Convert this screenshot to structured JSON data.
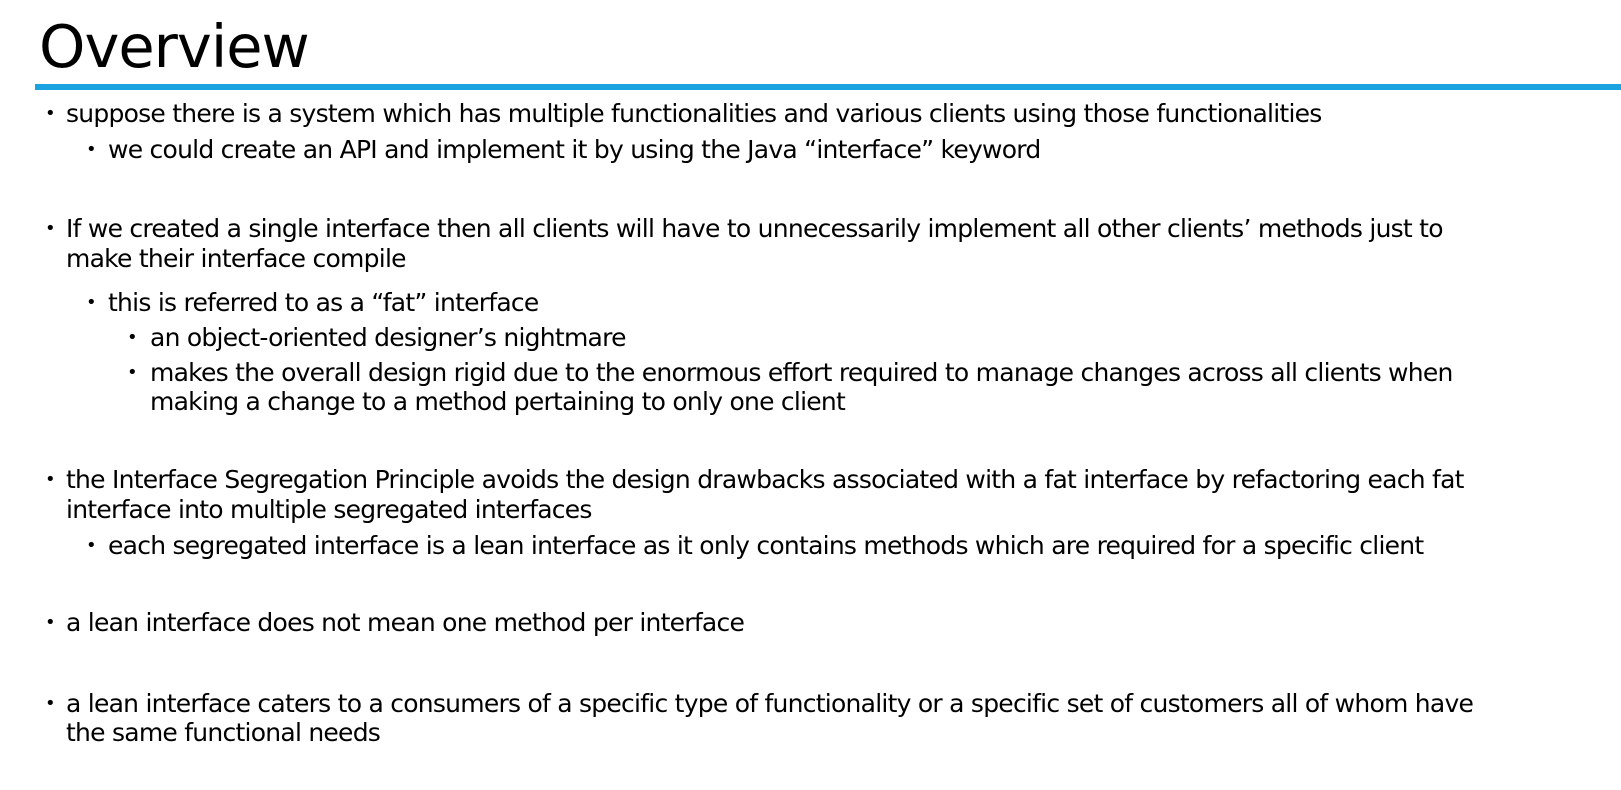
{
  "slide": {
    "title": "Overview",
    "accent_color": "#1aa3e0",
    "bullet_glyph": "•",
    "items": [
      {
        "level": 1,
        "text": "suppose there is a system which has multiple functionalities and various clients using those functionalities"
      },
      {
        "level": 2,
        "text": "we could create an API and implement it by using the Java “interface” keyword"
      },
      {
        "level": 1,
        "line1": "If we created a single interface then all clients will have to unnecessarily implement all other clients’ methods just to",
        "line2": "make their interface compile"
      },
      {
        "level": 2,
        "text": "this is referred to as a “fat” interface"
      },
      {
        "level": 3,
        "text": "an object-oriented designer’s nightmare"
      },
      {
        "level": 3,
        "line1": "makes the overall design rigid due to the enormous effort required to manage changes across all clients when",
        "line2": "making a change to a method pertaining to only one client"
      },
      {
        "level": 1,
        "line1": "the Interface Segregation Principle avoids the design drawbacks associated with a fat interface by refactoring each fat",
        "line2": "interface into multiple segregated interfaces"
      },
      {
        "level": 2,
        "text": "each segregated interface is a lean interface as it only contains methods which are required for a specific client"
      },
      {
        "level": 1,
        "text": "a lean interface does not mean one method per interface"
      },
      {
        "level": 1,
        "line1": "a lean interface caters to a consumers of a specific type of functionality or a specific set of customers all of whom have",
        "line2": "the same functional needs"
      }
    ]
  }
}
